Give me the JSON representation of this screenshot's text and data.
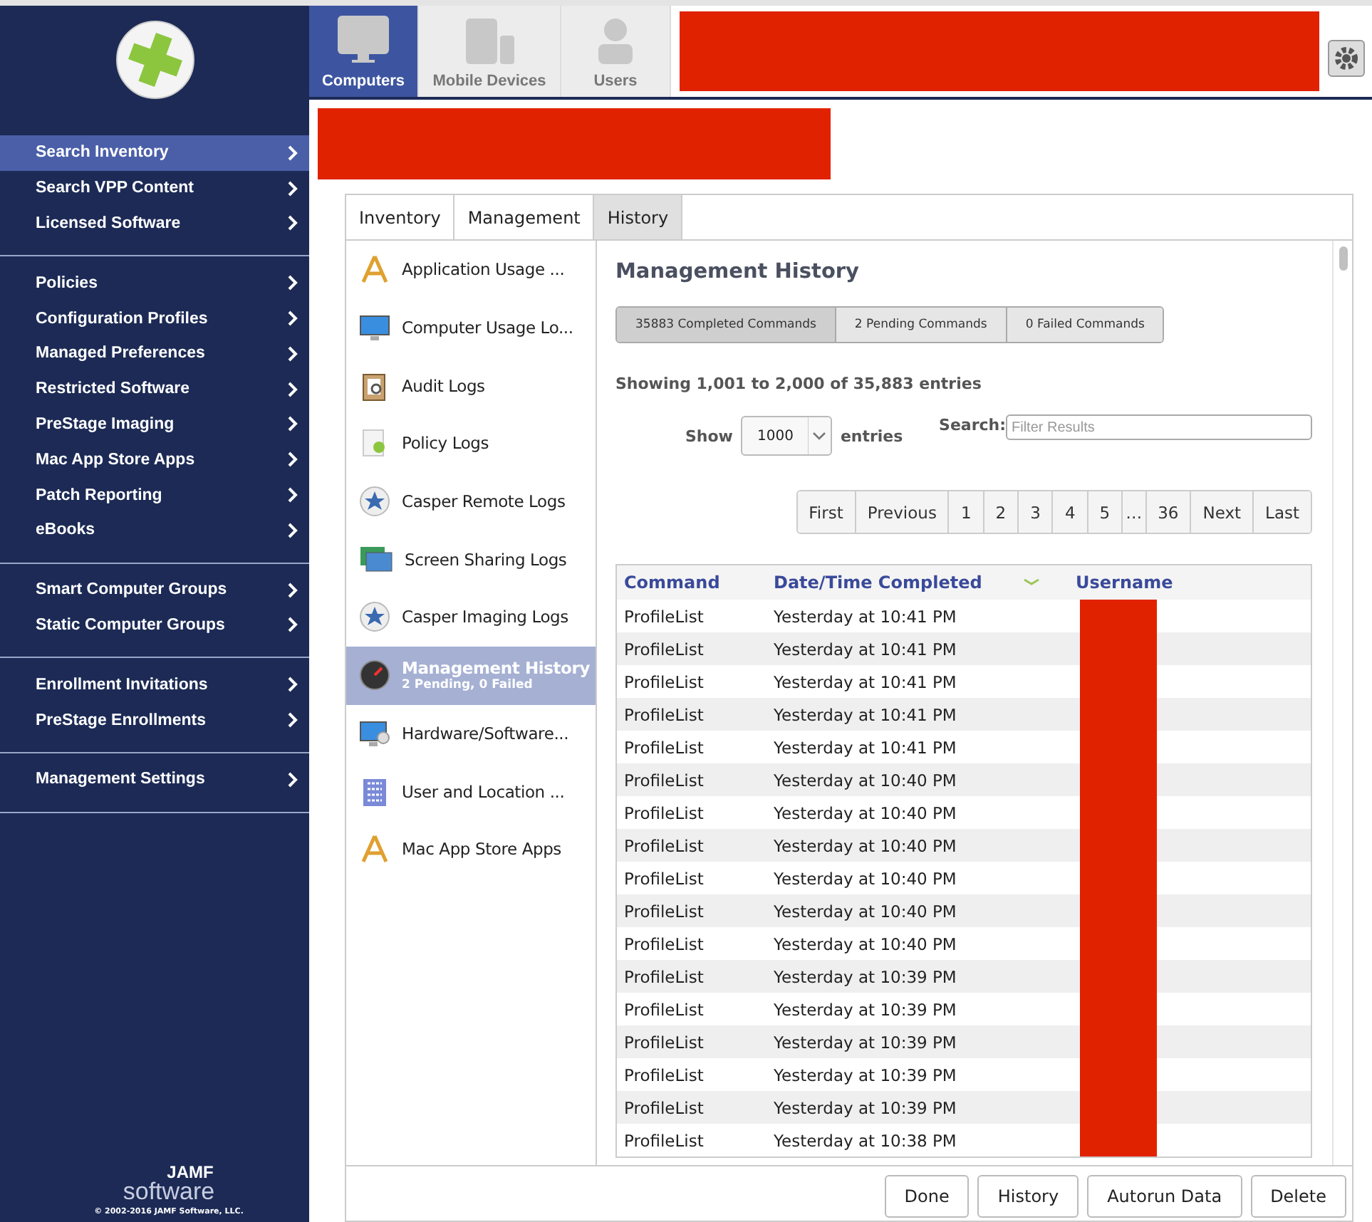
{
  "sidebar": {
    "groups": [
      {
        "items": [
          {
            "label": "Search Inventory",
            "selected": true
          },
          {
            "label": "Search VPP Content",
            "selected": false
          },
          {
            "label": "Licensed Software",
            "selected": false
          }
        ]
      },
      {
        "items": [
          {
            "label": "Policies",
            "selected": false
          },
          {
            "label": "Configuration Profiles",
            "selected": false
          },
          {
            "label": "Managed Preferences",
            "selected": false
          },
          {
            "label": "Restricted Software",
            "selected": false
          },
          {
            "label": "PreStage Imaging",
            "selected": false
          },
          {
            "label": "Mac App Store Apps",
            "selected": false
          },
          {
            "label": "Patch Reporting",
            "selected": false
          },
          {
            "label": "eBooks",
            "selected": false
          }
        ]
      },
      {
        "items": [
          {
            "label": "Smart Computer Groups",
            "selected": false
          },
          {
            "label": "Static Computer Groups",
            "selected": false
          }
        ]
      },
      {
        "items": [
          {
            "label": "Enrollment Invitations",
            "selected": false
          },
          {
            "label": "PreStage Enrollments",
            "selected": false
          }
        ]
      },
      {
        "items": [
          {
            "label": "Management Settings",
            "selected": false
          }
        ]
      }
    ],
    "footer": {
      "brand_top": "JAMF",
      "brand_bottom": "software",
      "copyright": "© 2002-2016 JAMF Software, LLC."
    }
  },
  "top_tabs": [
    {
      "label": "Computers",
      "selected": true
    },
    {
      "label": "Mobile Devices",
      "selected": false
    },
    {
      "label": "Users",
      "selected": false
    }
  ],
  "record_tabs": [
    {
      "label": "Inventory",
      "selected": false
    },
    {
      "label": "Management",
      "selected": false
    },
    {
      "label": "History",
      "selected": true
    }
  ],
  "history_nav": [
    {
      "label": "Application Usage ...",
      "selected": false
    },
    {
      "label": "Computer Usage Lo...",
      "selected": false
    },
    {
      "label": "Audit Logs",
      "selected": false
    },
    {
      "label": "Policy Logs",
      "selected": false
    },
    {
      "label": "Casper Remote Logs",
      "selected": false
    },
    {
      "label": "Screen Sharing Logs",
      "selected": false
    },
    {
      "label": "Casper Imaging Logs",
      "selected": false
    },
    {
      "label": "Management History",
      "subtitle": "2 Pending, 0 Failed",
      "selected": true
    },
    {
      "label": "Hardware/Software...",
      "selected": false
    },
    {
      "label": "User and Location ...",
      "selected": false
    },
    {
      "label": "Mac App Store Apps",
      "selected": false
    }
  ],
  "content": {
    "title": "Management History",
    "filters": [
      {
        "label": "35883 Completed Commands",
        "selected": true
      },
      {
        "label": "2 Pending Commands",
        "selected": false
      },
      {
        "label": "0 Failed Commands",
        "selected": false
      }
    ],
    "summary": "Showing 1,001 to 2,000 of 35,883 entries",
    "show_label": "Show",
    "show_value": "1000",
    "entries_label": "entries",
    "search_label": "Search:",
    "search_placeholder": "Filter Results",
    "pagination": [
      "First",
      "Previous",
      "1",
      "2",
      "3",
      "4",
      "5",
      "…",
      "36",
      "Next",
      "Last"
    ],
    "table": {
      "columns": [
        "Command",
        "Date/Time Completed",
        "Username"
      ],
      "rows": [
        [
          "ProfileList",
          "Yesterday at 10:41 PM"
        ],
        [
          "ProfileList",
          "Yesterday at 10:41 PM"
        ],
        [
          "ProfileList",
          "Yesterday at 10:41 PM"
        ],
        [
          "ProfileList",
          "Yesterday at 10:41 PM"
        ],
        [
          "ProfileList",
          "Yesterday at 10:41 PM"
        ],
        [
          "ProfileList",
          "Yesterday at 10:40 PM"
        ],
        [
          "ProfileList",
          "Yesterday at 10:40 PM"
        ],
        [
          "ProfileList",
          "Yesterday at 10:40 PM"
        ],
        [
          "ProfileList",
          "Yesterday at 10:40 PM"
        ],
        [
          "ProfileList",
          "Yesterday at 10:40 PM"
        ],
        [
          "ProfileList",
          "Yesterday at 10:40 PM"
        ],
        [
          "ProfileList",
          "Yesterday at 10:39 PM"
        ],
        [
          "ProfileList",
          "Yesterday at 10:39 PM"
        ],
        [
          "ProfileList",
          "Yesterday at 10:39 PM"
        ],
        [
          "ProfileList",
          "Yesterday at 10:39 PM"
        ],
        [
          "ProfileList",
          "Yesterday at 10:39 PM"
        ],
        [
          "ProfileList",
          "Yesterday at 10:38 PM"
        ]
      ]
    }
  },
  "buttons": [
    "Done",
    "History",
    "Autorun Data",
    "Delete"
  ]
}
